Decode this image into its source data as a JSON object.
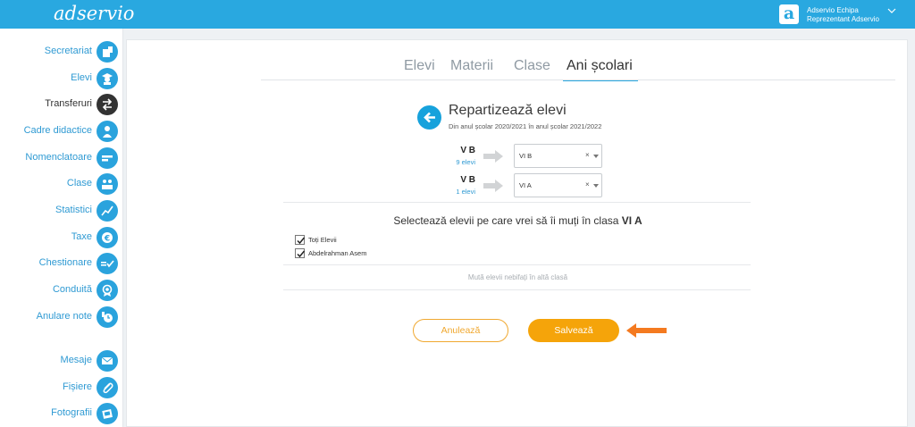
{
  "app": {
    "logo": "adservio",
    "user_initial": "a",
    "user_line1": "Adservio Echipa",
    "user_line2": "Reprezentant Adservio"
  },
  "sidebar": {
    "items": [
      {
        "label": "Secretariat",
        "icon": "secretariat-icon"
      },
      {
        "label": "Elevi",
        "icon": "students-icon"
      },
      {
        "label": "Transferuri",
        "icon": "transfer-icon",
        "active": true
      },
      {
        "label": "Cadre didactice",
        "icon": "teachers-icon"
      },
      {
        "label": "Nomenclatoare",
        "icon": "nomenclature-icon"
      },
      {
        "label": "Clase",
        "icon": "classes-icon"
      },
      {
        "label": "Statistici",
        "icon": "statistics-icon"
      },
      {
        "label": "Taxe",
        "icon": "euro-icon"
      },
      {
        "label": "Chestionare",
        "icon": "survey-icon"
      },
      {
        "label": "Conduită",
        "icon": "conduct-icon"
      },
      {
        "label": "Anulare note",
        "icon": "cancel-grades-icon"
      },
      {
        "label": "Mesaje",
        "icon": "mail-icon"
      },
      {
        "label": "Fișiere",
        "icon": "paperclip-icon"
      },
      {
        "label": "Fotografii",
        "icon": "photos-icon"
      }
    ]
  },
  "tabs": [
    {
      "label": "Elevi"
    },
    {
      "label": "Materii"
    },
    {
      "label": "Clase"
    },
    {
      "label": "Ani școlari",
      "active": true
    }
  ],
  "page": {
    "title": "Repartizează elevi",
    "subtitle": "Din anul școlar 2020/2021 în anul școlar 2021/2022"
  },
  "rows": [
    {
      "from_class": "V B",
      "count": "9 elevi",
      "to_class": "VI B",
      "clear": "×"
    },
    {
      "from_class": "V B",
      "count": "1 elevi",
      "to_class": "VI A",
      "clear": "×"
    }
  ],
  "select_students": {
    "message": "Selectează elevii pe care vrei să îi muți în clasa ",
    "target_class": "VI A",
    "options": [
      {
        "label": "Toți Elevii",
        "checked": true
      },
      {
        "label": "Abdelrahman Asem",
        "checked": true
      }
    ]
  },
  "move_note": "Mută elevii nebifați în altă clasă",
  "actions": {
    "cancel": "Anulează",
    "save": "Salvează"
  },
  "colors": {
    "brand": "#29a8e0",
    "accent_orange": "#f5a40a",
    "annotation_arrow": "#f47a20"
  }
}
